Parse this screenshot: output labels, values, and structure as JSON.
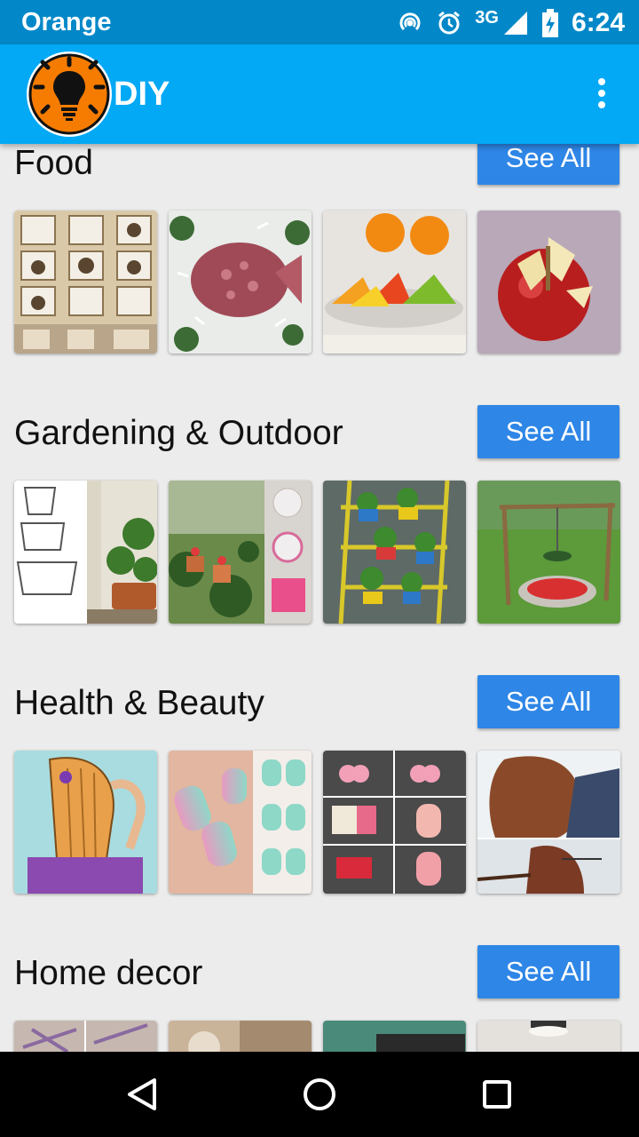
{
  "status_bar": {
    "carrier": "Orange",
    "network": "3G",
    "time": "6:24",
    "icons": [
      "hotspot-icon",
      "alarm-icon",
      "signal-icon",
      "battery-charging-icon"
    ]
  },
  "app_bar": {
    "title": "DIY",
    "logo_icon": "lightbulb-icon",
    "menu_icon": "overflow-menu-icon"
  },
  "sections": [
    {
      "title": "Food",
      "button": "See All",
      "thumbnails": [
        "cups-layered-dessert",
        "salami-fish-platter",
        "orange-jelly-slices",
        "apple-butterfly-carving"
      ]
    },
    {
      "title": "Gardening & Outdoor",
      "button": "See All",
      "thumbnails": [
        "stacked-pot-planter",
        "painted-garden-pots",
        "vertical-pot-trellis",
        "hanging-flower-swing"
      ]
    },
    {
      "title": "Health & Beauty",
      "button": "See All",
      "thumbnails": [
        "braiding-hair-illustration",
        "gradient-mint-nails",
        "sponge-nail-tutorial",
        "hair-wave-steps"
      ]
    },
    {
      "title": "Home decor",
      "button": "See All",
      "thumbnails": [
        "decor-1",
        "decor-2",
        "decor-3",
        "decor-4"
      ]
    }
  ],
  "nav_bar": {
    "icons": [
      "back-icon",
      "home-icon",
      "recents-icon"
    ]
  },
  "colors": {
    "status_bar": "#0288c8",
    "app_bar": "#03a9f4",
    "button": "#2e86e6",
    "background": "#ececec",
    "logo_orange": "#f57c00"
  }
}
